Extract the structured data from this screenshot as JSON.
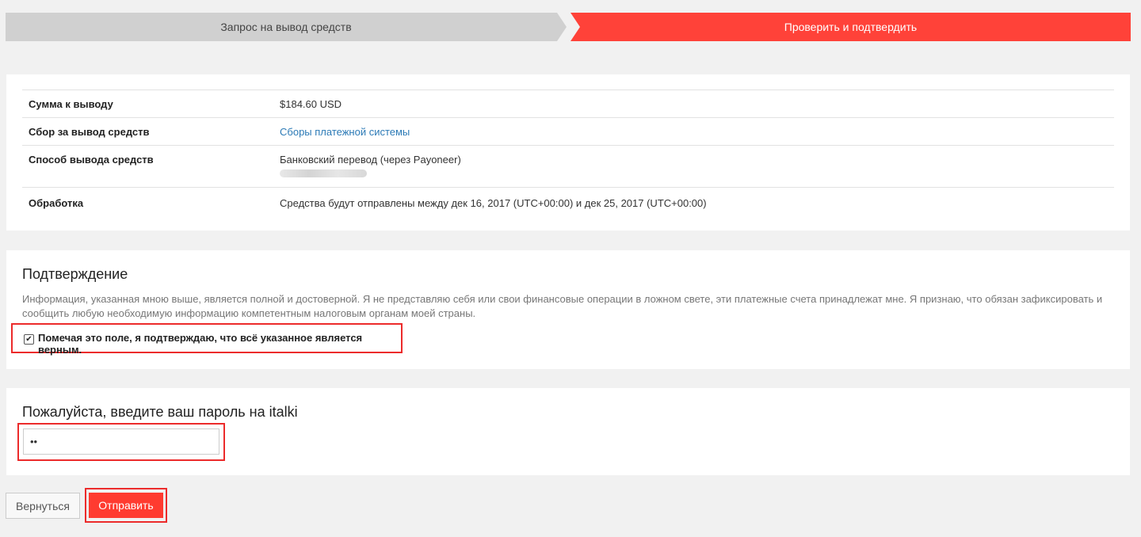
{
  "steps": [
    {
      "label": "Запрос на вывод средств",
      "active": false
    },
    {
      "label": "Проверить и подтвердить",
      "active": true
    }
  ],
  "summary": {
    "rows": [
      {
        "label": "Сумма к выводу",
        "value": "$184.60 USD"
      },
      {
        "label": "Сбор за вывод средств",
        "value": "Сборы платежной системы"
      },
      {
        "label": "Способ вывода средств",
        "value": "Банковский перевод (через Payoneer)"
      },
      {
        "label": "Обработка",
        "value": "Средства будут отправлены между дек 16, 2017 (UTC+00:00) и дек 25, 2017 (UTC+00:00)"
      }
    ]
  },
  "confirmation": {
    "title": "Подтверждение",
    "text": "Информация, указанная мною выше, является полной и достоверной. Я не представляю себя или свои финансовые операции в ложном свете, эти платежные счета принадлежат мне. Я признаю, что обязан зафиксировать и сообщить любую необходимую информацию компетентным налоговым органам моей страны.",
    "checkbox_label": "Помечая это поле, я подтверждаю, что всё указанное является верным.",
    "checked": true,
    "checkbox_mark": "✔"
  },
  "password": {
    "title": "Пожалуйста, введите ваш пароль на italki",
    "value": "••"
  },
  "buttons": {
    "back": "Вернуться",
    "submit": "Отправить"
  },
  "colors": {
    "accent": "#ff4239",
    "highlight_border": "#ec2b2b",
    "link": "#2c7ab6",
    "inactive_step": "#d0d0d0"
  }
}
